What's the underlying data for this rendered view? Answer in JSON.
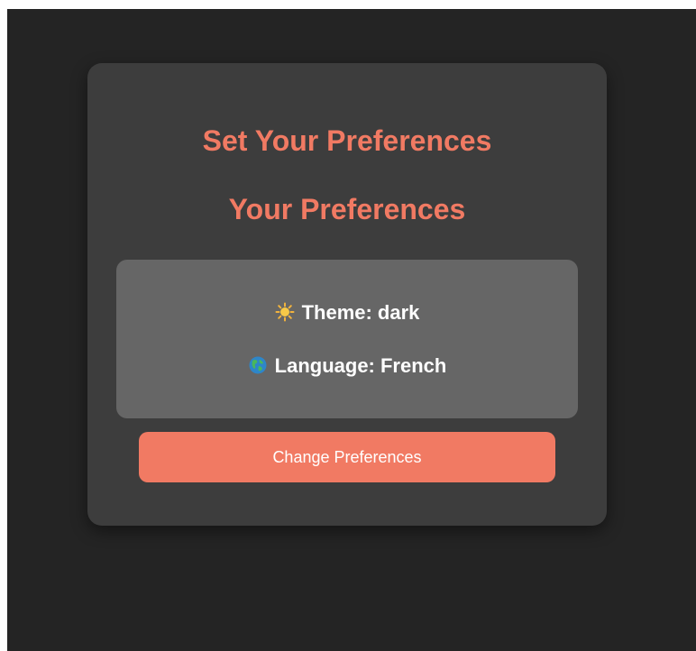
{
  "card": {
    "title": "Set Your Preferences",
    "subtitle": "Your Preferences"
  },
  "preferences": {
    "theme": {
      "icon": "sun-icon",
      "text": "Theme: dark"
    },
    "language": {
      "icon": "globe-icon",
      "text": "Language: French"
    }
  },
  "actions": {
    "change_label": "Change Preferences"
  },
  "colors": {
    "background": "#242424",
    "card": "#3d3d3d",
    "panel": "#666666",
    "accent": "#f17a63",
    "text": "#ffffff"
  }
}
